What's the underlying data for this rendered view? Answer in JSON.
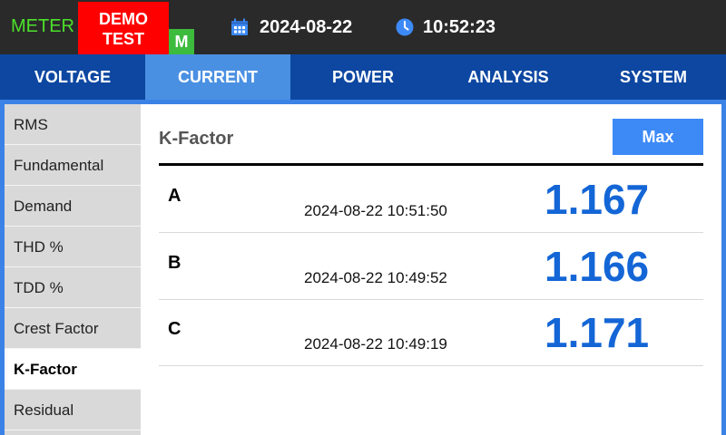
{
  "header": {
    "meter_label": "METER",
    "demo_line1": "DEMO",
    "demo_line2": "TEST",
    "mode_badge": "M",
    "date": "2024-08-22",
    "time": "10:52:23",
    "colors": {
      "meter": "#4ce02a",
      "demo_bg": "#ff0000",
      "badge_bg": "#3dbb3d"
    }
  },
  "tabs": [
    {
      "label": "VOLTAGE",
      "active": false
    },
    {
      "label": "CURRENT",
      "active": true
    },
    {
      "label": "POWER",
      "active": false
    },
    {
      "label": "ANALYSIS",
      "active": false
    },
    {
      "label": "SYSTEM",
      "active": false
    }
  ],
  "sidebar": {
    "items": [
      {
        "label": "RMS",
        "active": false
      },
      {
        "label": "Fundamental",
        "active": false
      },
      {
        "label": "Demand",
        "active": false
      },
      {
        "label": "THD %",
        "active": false
      },
      {
        "label": "TDD %",
        "active": false
      },
      {
        "label": "Crest Factor",
        "active": false
      },
      {
        "label": "K-Factor",
        "active": true
      },
      {
        "label": "Residual",
        "active": false
      }
    ]
  },
  "panel": {
    "title": "K-Factor",
    "max_button": "Max",
    "rows": [
      {
        "phase": "A",
        "timestamp": "2024-08-22 10:51:50",
        "value": "1.167"
      },
      {
        "phase": "B",
        "timestamp": "2024-08-22 10:49:52",
        "value": "1.166"
      },
      {
        "phase": "C",
        "timestamp": "2024-08-22 10:49:19",
        "value": "1.171"
      }
    ],
    "colors": {
      "value": "#1466d6",
      "button": "#3d8af7"
    }
  }
}
